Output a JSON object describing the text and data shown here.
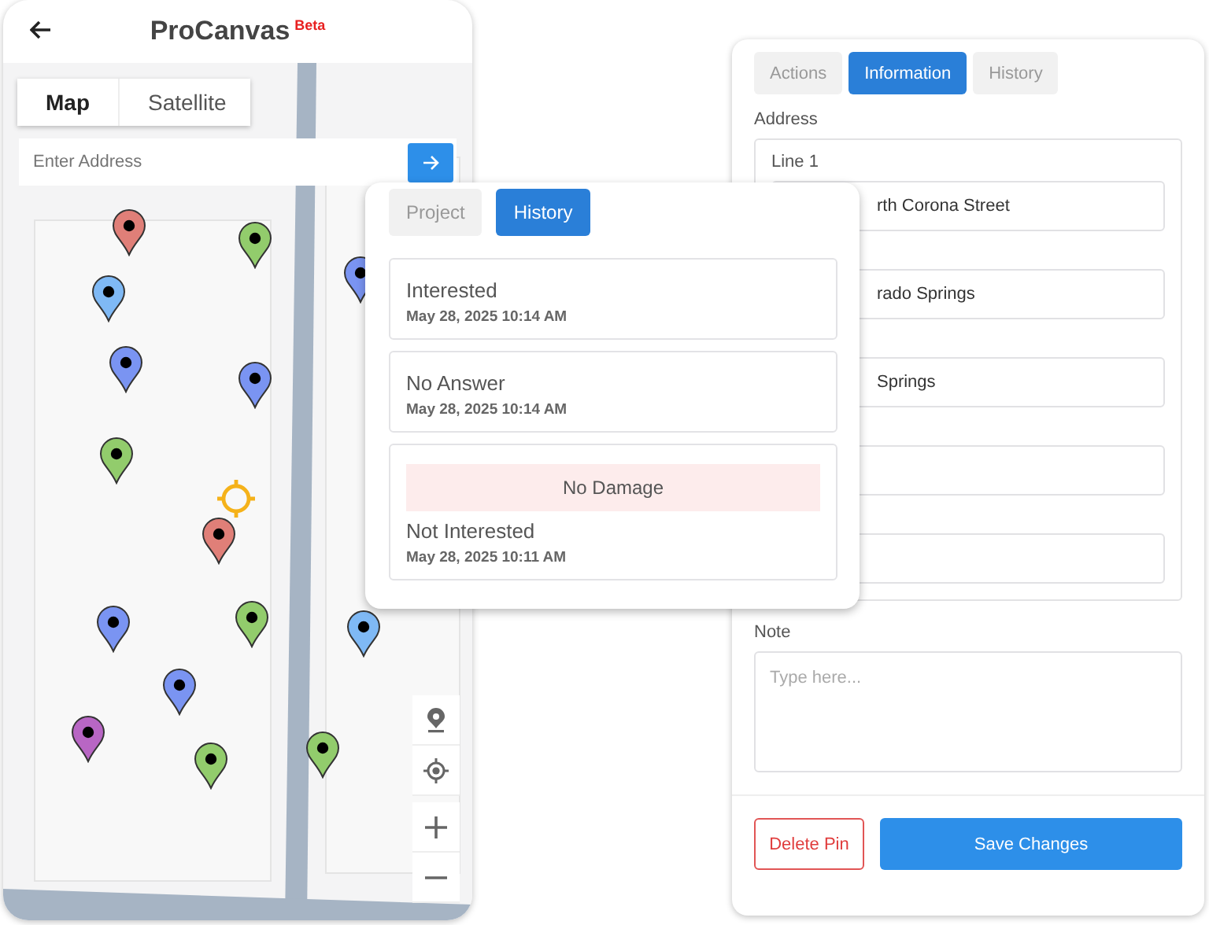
{
  "map_screen": {
    "title": "ProCanvas",
    "badge": "Beta",
    "map_type_tabs": [
      {
        "label": "Map",
        "selected": true
      },
      {
        "label": "Satellite",
        "selected": false
      }
    ],
    "address_search": {
      "placeholder": "Enter Address"
    },
    "pins": [
      {
        "color": "#e07f78"
      },
      {
        "color": "#92cc6c"
      },
      {
        "color": "#7fb9f5"
      },
      {
        "color": "#7a94f2"
      },
      {
        "color": "#7a94f2"
      },
      {
        "color": "#92cc6c"
      },
      {
        "color": "#e07f78"
      },
      {
        "color": "#7a94f2"
      },
      {
        "color": "#92cc6c"
      },
      {
        "color": "#7a94f2"
      },
      {
        "color": "#b866c4"
      },
      {
        "color": "#92cc6c"
      },
      {
        "color": "#92cc6c"
      },
      {
        "color": "#7a94f2"
      },
      {
        "color": "#7fb9f5"
      }
    ]
  },
  "history_popover": {
    "tabs": [
      {
        "label": "Project",
        "selected": false
      },
      {
        "label": "History",
        "selected": true
      }
    ],
    "entries": [
      {
        "status": "Interested",
        "time": "May 28, 2025 10:14 AM"
      },
      {
        "status": "No Answer",
        "time": "May 28, 2025 10:14 AM"
      },
      {
        "tag": "No Damage",
        "status": "Not Interested",
        "time": "May 28, 2025 10:11 AM"
      }
    ]
  },
  "pin_details": {
    "tabs": [
      {
        "label": "Actions",
        "selected": false
      },
      {
        "label": "Information",
        "selected": true
      },
      {
        "label": "History",
        "selected": false
      }
    ],
    "address_label": "Address",
    "line_label": "Line 1",
    "fields": [
      {
        "kind": "text",
        "value": "rth Corona Street"
      },
      {
        "kind": "text",
        "value": "rado Springs"
      },
      {
        "kind": "text",
        "value": "Springs"
      },
      {
        "kind": "empty"
      },
      {
        "kind": "empty"
      }
    ],
    "note_label": "Note",
    "note": {
      "placeholder": "Type here..."
    },
    "buttons": [
      {
        "kind": "danger",
        "label": "Delete Pin"
      },
      {
        "kind": "primary",
        "label": "Save Changes"
      }
    ]
  }
}
